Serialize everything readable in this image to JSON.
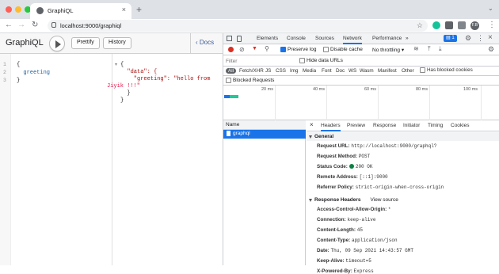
{
  "browser": {
    "tab_title": "GraphiQL",
    "new_tab": "+",
    "url": "localhost:9000/graphiql",
    "profile": "F.B"
  },
  "graphiql": {
    "title": "GraphiQL",
    "prettify_label": "Prettify",
    "history_label": "History",
    "docs_label": "Docs",
    "query_lines": [
      "{",
      "  greeting",
      "}"
    ],
    "result_lines": [
      "{",
      "  \"data\": {",
      "    \"greeting\": \"hello from",
      "Jiyik !!!\"",
      "  }",
      "}"
    ]
  },
  "devtools": {
    "tabs": [
      "Elements",
      "Console",
      "Sources",
      "Network",
      "Performance",
      "»"
    ],
    "active_tab": "Network",
    "badge": "1",
    "toolbar": {
      "preserve_log": "Preserve log",
      "disable_cache": "Disable cache",
      "throttling": "No throttling"
    },
    "filter_placeholder": "Filter",
    "hide_data_urls": "Hide data URLs",
    "types": [
      "All",
      "Fetch/XHR",
      "JS",
      "CSS",
      "Img",
      "Media",
      "Font",
      "Doc",
      "WS",
      "Wasm",
      "Manifest",
      "Other"
    ],
    "has_blocked_cookies": "Has blocked cookies",
    "blocked_requests": "Blocked Requests",
    "timeline_ticks": [
      "20 ms",
      "40 ms",
      "60 ms",
      "80 ms",
      "100 ms"
    ],
    "name_header": "Name",
    "request_name": "graphql",
    "detail_tabs": [
      "Headers",
      "Preview",
      "Response",
      "Initiator",
      "Timing",
      "Cookies"
    ],
    "general_title": "General",
    "general": [
      {
        "k": "Request URL:",
        "v": "http://localhost:9000/graphql?"
      },
      {
        "k": "Request Method:",
        "v": "POST"
      },
      {
        "k": "Status Code:",
        "v": "200 OK"
      },
      {
        "k": "Remote Address:",
        "v": "[::1]:9000"
      },
      {
        "k": "Referrer Policy:",
        "v": "strict-origin-when-cross-origin"
      }
    ],
    "response_headers_title": "Response Headers",
    "view_source": "View source",
    "response_headers": [
      {
        "k": "Access-Control-Allow-Origin:",
        "v": "*"
      },
      {
        "k": "Connection:",
        "v": "keep-alive"
      },
      {
        "k": "Content-Length:",
        "v": "45"
      },
      {
        "k": "Content-Type:",
        "v": "application/json"
      },
      {
        "k": "Date:",
        "v": "Thu, 09 Sep 2021 14:43:57 GMT"
      },
      {
        "k": "Keep-Alive:",
        "v": "timeout=5"
      },
      {
        "k": "X-Powered-By:",
        "v": "Express"
      }
    ]
  },
  "colors": {
    "accent": "#1a73e8",
    "status_ok": "#0b8043",
    "json_key": "#a11",
    "json_string": "#d14"
  }
}
